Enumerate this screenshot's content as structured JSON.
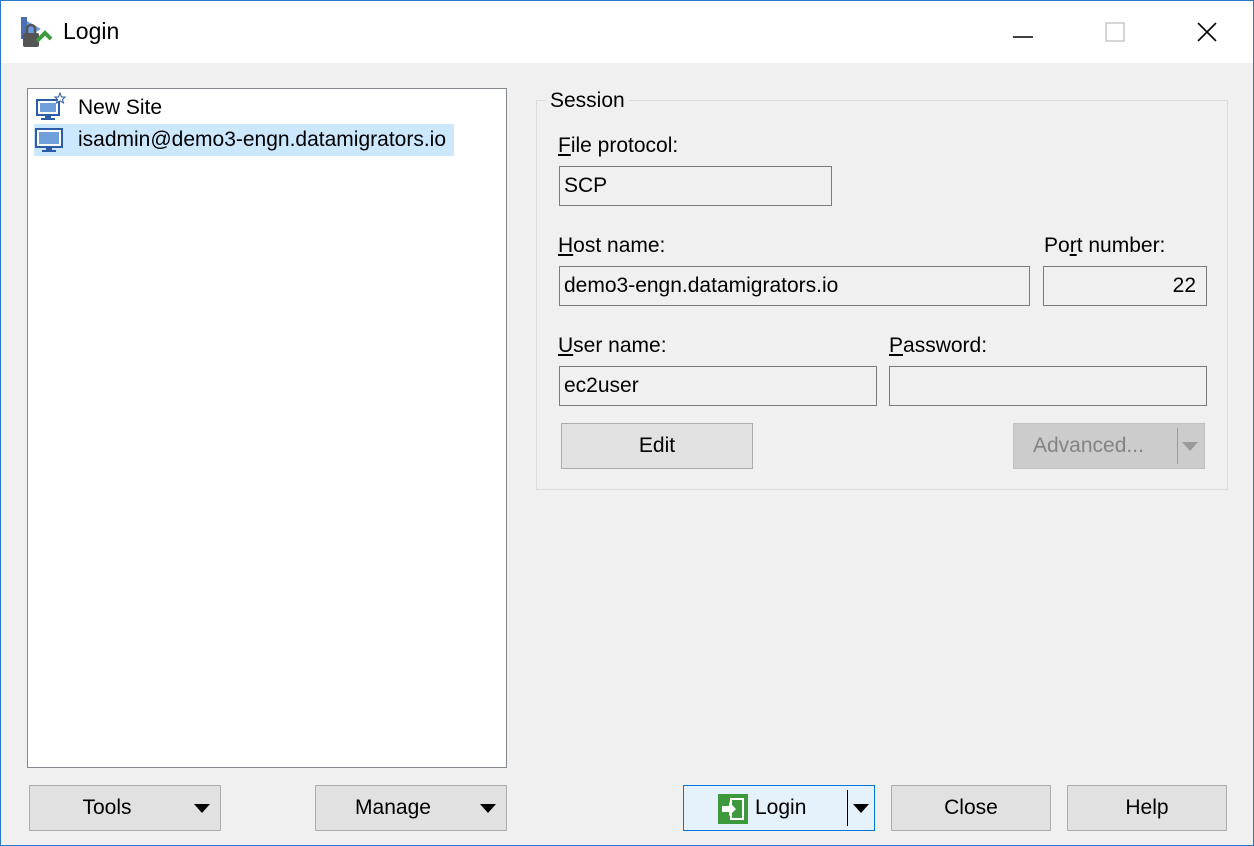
{
  "window": {
    "title": "Login"
  },
  "site_tree": {
    "items": [
      {
        "label": "New Site",
        "icon": "new-site-icon",
        "selected": false
      },
      {
        "label": "isadmin@demo3-engn.datamigrators.io",
        "icon": "computer-icon",
        "selected": true
      }
    ]
  },
  "session": {
    "legend": "Session",
    "file_protocol": {
      "label_first": "F",
      "label_rest": "ile protocol:",
      "value": "SCP"
    },
    "host_name": {
      "label_first": "H",
      "label_rest": "ost name:",
      "value": "demo3-engn.datamigrators.io"
    },
    "port_number": {
      "label_before": "Po",
      "label_u": "r",
      "label_after": "t number:",
      "value": "22"
    },
    "user_name": {
      "label_first": "U",
      "label_rest": "ser name:",
      "value": "ec2user"
    },
    "password": {
      "label_first": "P",
      "label_rest": "assword:",
      "value": ""
    },
    "edit_label": "Edit",
    "advanced_label": "Advanced..."
  },
  "footer": {
    "tools_label": "Tools",
    "manage_label": "Manage",
    "login_label": "Login",
    "close_label": "Close",
    "help_label": "Help"
  },
  "colors": {
    "accent": "#0078d7",
    "selection": "#cce8ff",
    "login_icon_green": "#3c9a3c"
  }
}
